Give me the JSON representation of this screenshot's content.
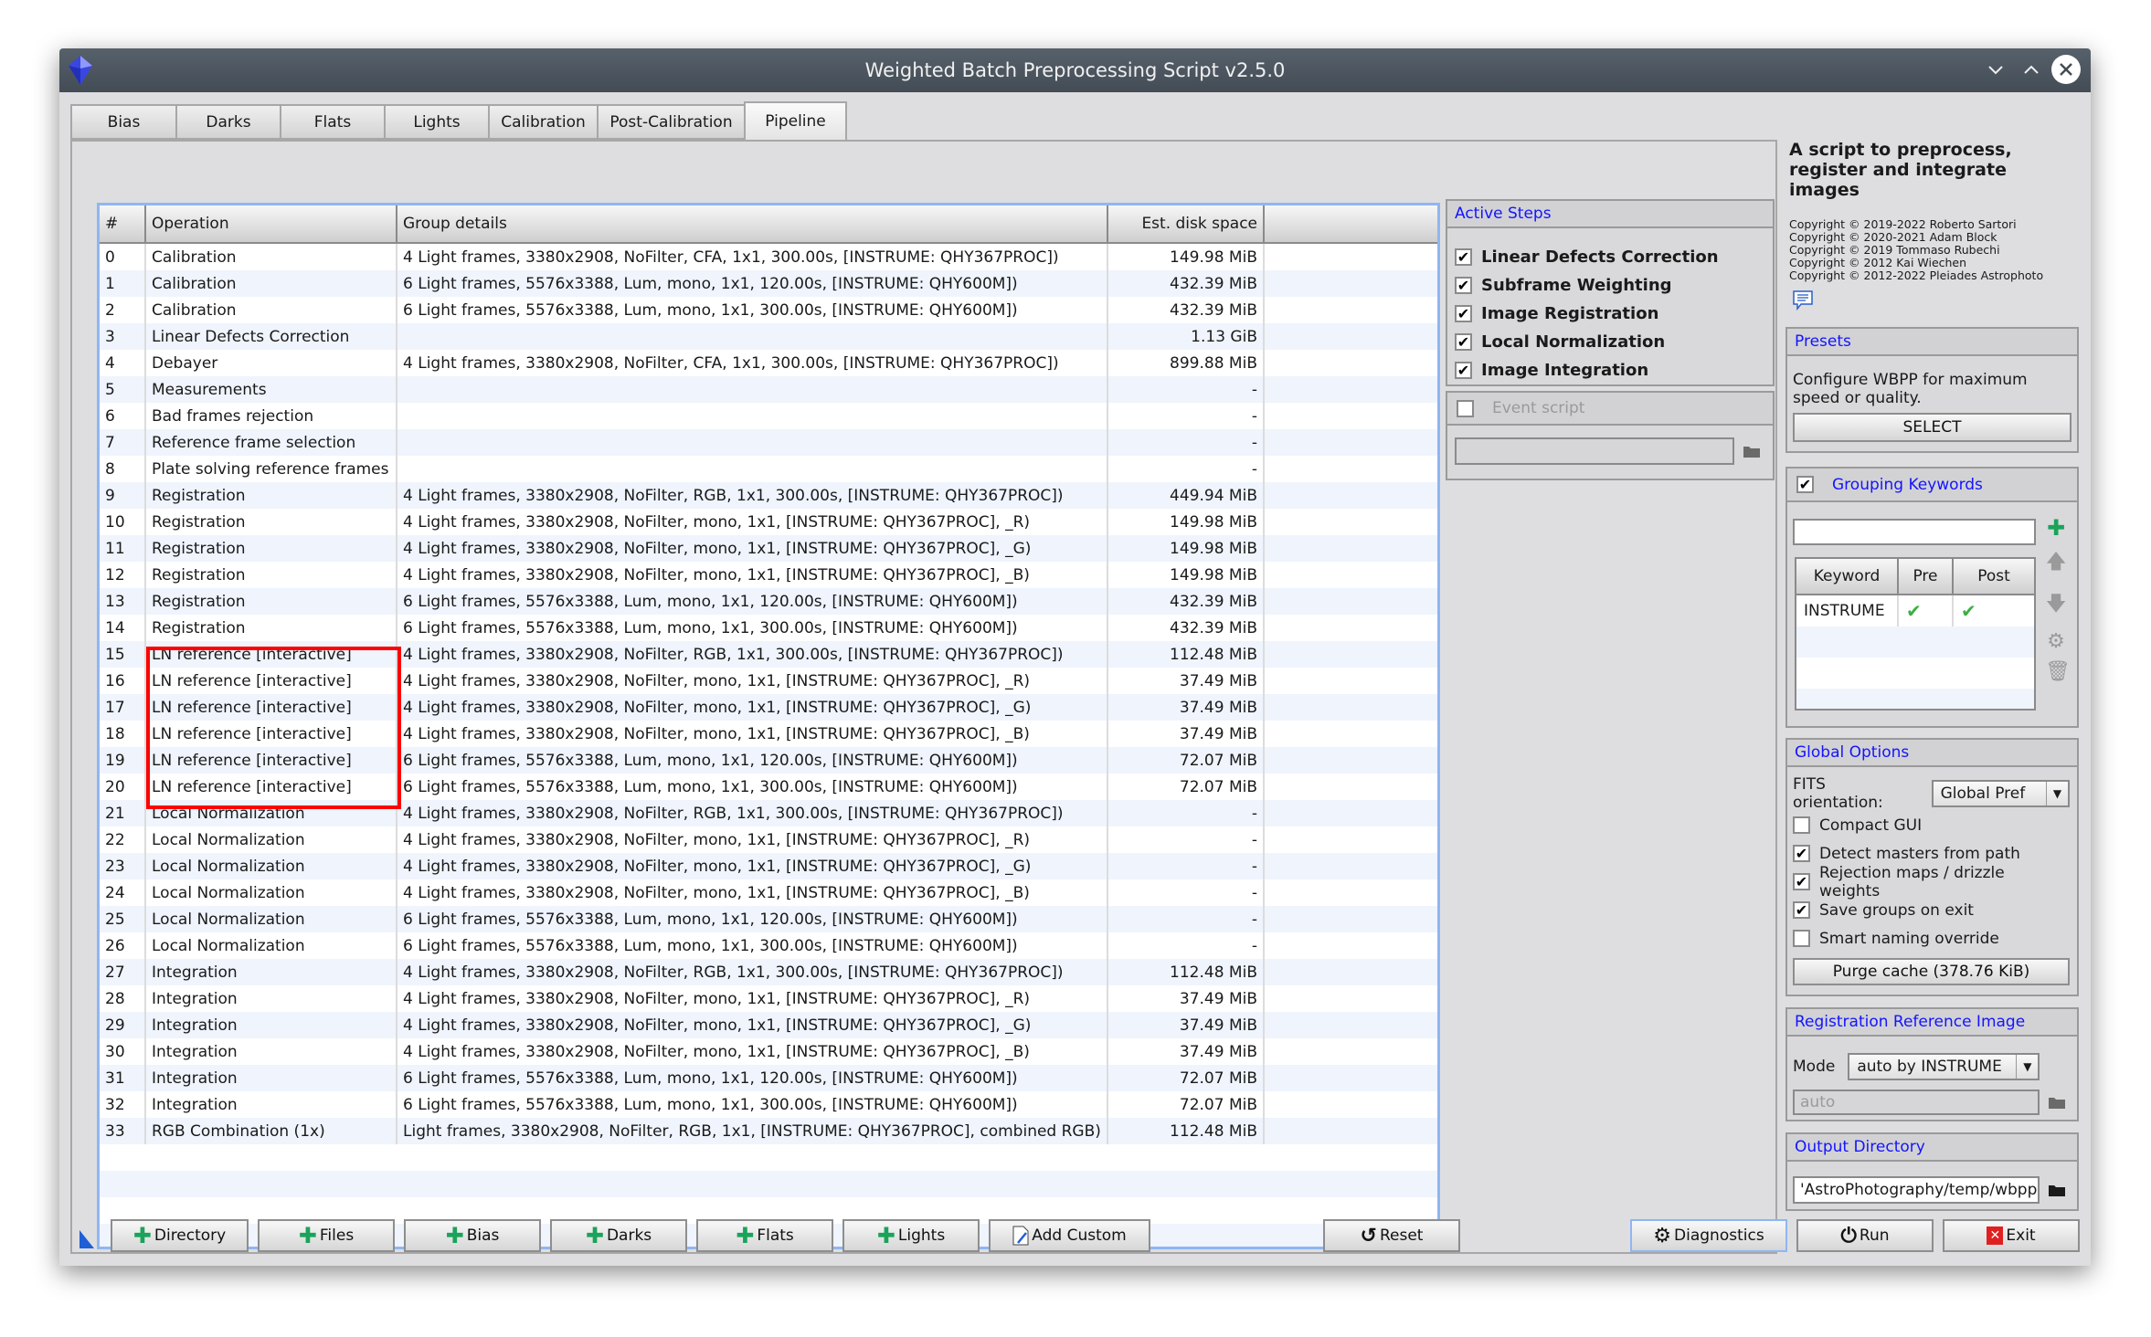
{
  "window": {
    "title": "Weighted Batch Preprocessing Script v2.5.0"
  },
  "tabs": [
    {
      "label": "Bias",
      "active": false
    },
    {
      "label": "Darks",
      "active": false
    },
    {
      "label": "Flats",
      "active": false
    },
    {
      "label": "Lights",
      "active": false
    },
    {
      "label": "Calibration",
      "active": false
    },
    {
      "label": "Post-Calibration",
      "active": false
    },
    {
      "label": "Pipeline",
      "active": true
    }
  ],
  "pipeline_table": {
    "headers": [
      "#",
      "Operation",
      "Group details",
      "Est. disk space",
      ""
    ],
    "rows": [
      {
        "n": "0",
        "op": "Calibration",
        "details": "4 Light frames, 3380x2908, NoFilter, CFA, 1x1, 300.00s, [INSTRUME: QHY367PROC])",
        "disk": "149.98 MiB"
      },
      {
        "n": "1",
        "op": "Calibration",
        "details": "6 Light frames, 5576x3388, Lum, mono, 1x1, 120.00s, [INSTRUME: QHY600M])",
        "disk": "432.39 MiB"
      },
      {
        "n": "2",
        "op": "Calibration",
        "details": "6 Light frames, 5576x3388, Lum, mono, 1x1, 300.00s, [INSTRUME: QHY600M])",
        "disk": "432.39 MiB"
      },
      {
        "n": "3",
        "op": "Linear Defects Correction",
        "details": "",
        "disk": "1.13 GiB"
      },
      {
        "n": "4",
        "op": "Debayer",
        "details": "4 Light frames, 3380x2908, NoFilter, CFA, 1x1, 300.00s, [INSTRUME: QHY367PROC])",
        "disk": "899.88 MiB"
      },
      {
        "n": "5",
        "op": "Measurements",
        "details": "",
        "disk": "-"
      },
      {
        "n": "6",
        "op": "Bad frames rejection",
        "details": "",
        "disk": "-"
      },
      {
        "n": "7",
        "op": "Reference frame selection",
        "details": "",
        "disk": "-"
      },
      {
        "n": "8",
        "op": "Plate solving reference frames",
        "details": "",
        "disk": "-"
      },
      {
        "n": "9",
        "op": "Registration",
        "details": "4 Light frames, 3380x2908, NoFilter, RGB, 1x1, 300.00s, [INSTRUME: QHY367PROC])",
        "disk": "449.94 MiB"
      },
      {
        "n": "10",
        "op": "Registration",
        "details": "4 Light frames, 3380x2908, NoFilter, mono, 1x1, [INSTRUME: QHY367PROC], _R)",
        "disk": "149.98 MiB"
      },
      {
        "n": "11",
        "op": "Registration",
        "details": "4 Light frames, 3380x2908, NoFilter, mono, 1x1, [INSTRUME: QHY367PROC], _G)",
        "disk": "149.98 MiB"
      },
      {
        "n": "12",
        "op": "Registration",
        "details": "4 Light frames, 3380x2908, NoFilter, mono, 1x1, [INSTRUME: QHY367PROC], _B)",
        "disk": "149.98 MiB"
      },
      {
        "n": "13",
        "op": "Registration",
        "details": "6 Light frames, 5576x3388, Lum, mono, 1x1, 120.00s, [INSTRUME: QHY600M])",
        "disk": "432.39 MiB"
      },
      {
        "n": "14",
        "op": "Registration",
        "details": "6 Light frames, 5576x3388, Lum, mono, 1x1, 300.00s, [INSTRUME: QHY600M])",
        "disk": "432.39 MiB"
      },
      {
        "n": "15",
        "op": "LN reference [interactive]",
        "details": "4 Light frames, 3380x2908, NoFilter, RGB, 1x1, 300.00s, [INSTRUME: QHY367PROC])",
        "disk": "112.48 MiB"
      },
      {
        "n": "16",
        "op": "LN reference [interactive]",
        "details": "4 Light frames, 3380x2908, NoFilter, mono, 1x1, [INSTRUME: QHY367PROC], _R)",
        "disk": "37.49 MiB"
      },
      {
        "n": "17",
        "op": "LN reference [interactive]",
        "details": "4 Light frames, 3380x2908, NoFilter, mono, 1x1, [INSTRUME: QHY367PROC], _G)",
        "disk": "37.49 MiB"
      },
      {
        "n": "18",
        "op": "LN reference [interactive]",
        "details": "4 Light frames, 3380x2908, NoFilter, mono, 1x1, [INSTRUME: QHY367PROC], _B)",
        "disk": "37.49 MiB"
      },
      {
        "n": "19",
        "op": "LN reference [interactive]",
        "details": "6 Light frames, 5576x3388, Lum, mono, 1x1, 120.00s, [INSTRUME: QHY600M])",
        "disk": "72.07 MiB"
      },
      {
        "n": "20",
        "op": "LN reference [interactive]",
        "details": "6 Light frames, 5576x3388, Lum, mono, 1x1, 300.00s, [INSTRUME: QHY600M])",
        "disk": "72.07 MiB"
      },
      {
        "n": "21",
        "op": "Local Normalization",
        "details": "4 Light frames, 3380x2908, NoFilter, RGB, 1x1, 300.00s, [INSTRUME: QHY367PROC])",
        "disk": "-"
      },
      {
        "n": "22",
        "op": "Local Normalization",
        "details": "4 Light frames, 3380x2908, NoFilter, mono, 1x1, [INSTRUME: QHY367PROC], _R)",
        "disk": "-"
      },
      {
        "n": "23",
        "op": "Local Normalization",
        "details": "4 Light frames, 3380x2908, NoFilter, mono, 1x1, [INSTRUME: QHY367PROC], _G)",
        "disk": "-"
      },
      {
        "n": "24",
        "op": "Local Normalization",
        "details": "4 Light frames, 3380x2908, NoFilter, mono, 1x1, [INSTRUME: QHY367PROC], _B)",
        "disk": "-"
      },
      {
        "n": "25",
        "op": "Local Normalization",
        "details": "6 Light frames, 5576x3388, Lum, mono, 1x1, 120.00s, [INSTRUME: QHY600M])",
        "disk": "-"
      },
      {
        "n": "26",
        "op": "Local Normalization",
        "details": "6 Light frames, 5576x3388, Lum, mono, 1x1, 300.00s, [INSTRUME: QHY600M])",
        "disk": "-"
      },
      {
        "n": "27",
        "op": "Integration",
        "details": "4 Light frames, 3380x2908, NoFilter, RGB, 1x1, 300.00s, [INSTRUME: QHY367PROC])",
        "disk": "112.48 MiB"
      },
      {
        "n": "28",
        "op": "Integration",
        "details": "4 Light frames, 3380x2908, NoFilter, mono, 1x1, [INSTRUME: QHY367PROC], _R)",
        "disk": "37.49 MiB"
      },
      {
        "n": "29",
        "op": "Integration",
        "details": "4 Light frames, 3380x2908, NoFilter, mono, 1x1, [INSTRUME: QHY367PROC], _G)",
        "disk": "37.49 MiB"
      },
      {
        "n": "30",
        "op": "Integration",
        "details": "4 Light frames, 3380x2908, NoFilter, mono, 1x1, [INSTRUME: QHY367PROC], _B)",
        "disk": "37.49 MiB"
      },
      {
        "n": "31",
        "op": "Integration",
        "details": "6 Light frames, 5576x3388, Lum, mono, 1x1, 120.00s, [INSTRUME: QHY600M])",
        "disk": "72.07 MiB"
      },
      {
        "n": "32",
        "op": "Integration",
        "details": "6 Light frames, 5576x3388, Lum, mono, 1x1, 300.00s, [INSTRUME: QHY600M])",
        "disk": "72.07 MiB"
      },
      {
        "n": "33",
        "op": "RGB Combination (1x)",
        "details": "Light frames, 3380x2908, NoFilter, RGB, 1x1, [INSTRUME: QHY367PROC], combined RGB)",
        "disk": "112.48 MiB"
      }
    ],
    "highlighted_rows": [
      "15",
      "16",
      "17",
      "18",
      "19",
      "20"
    ]
  },
  "active_steps": {
    "title": "Active Steps",
    "items": [
      {
        "label": "Linear Defects Correction",
        "checked": true
      },
      {
        "label": "Subframe Weighting",
        "checked": true
      },
      {
        "label": "Image Registration",
        "checked": true
      },
      {
        "label": "Local Normalization",
        "checked": true
      },
      {
        "label": "Image Integration",
        "checked": true
      }
    ]
  },
  "event_script": {
    "label": "Event script",
    "checked": false,
    "value": ""
  },
  "about": {
    "heading": "A script to preprocess, register and integrate images",
    "copyrights": [
      "Copyright © 2019-2022 Roberto Sartori",
      "Copyright © 2020-2021 Adam Block",
      "Copyright © 2019 Tommaso Rubechi",
      "Copyright © 2012 Kai Wiechen",
      "Copyright © 2012-2022 Pleiades Astrophoto"
    ]
  },
  "presets": {
    "title": "Presets",
    "description": "Configure WBPP for maximum speed or quality.",
    "select_label": "SELECT"
  },
  "grouping_keywords": {
    "title": "Grouping Keywords",
    "enabled": true,
    "input_value": "",
    "headers": [
      "Keyword",
      "Pre",
      "Post"
    ],
    "rows": [
      {
        "keyword": "INSTRUME",
        "pre": true,
        "post": true
      }
    ]
  },
  "global_options": {
    "title": "Global Options",
    "fits_orientation_label": "FITS orientation:",
    "fits_orientation_value": "Global Pref",
    "options": [
      {
        "label": "Compact GUI",
        "checked": false
      },
      {
        "label": "Detect masters from path",
        "checked": true
      },
      {
        "label": "Rejection maps / drizzle weights",
        "checked": true
      },
      {
        "label": "Save groups on exit",
        "checked": true
      },
      {
        "label": "Smart naming override",
        "checked": false
      }
    ],
    "purge_label": "Purge cache (378.76 KiB)"
  },
  "registration_reference": {
    "title": "Registration Reference Image",
    "mode_label": "Mode",
    "mode_value": "auto by INSTRUME",
    "path_value": "auto"
  },
  "output_directory": {
    "title": "Output Directory",
    "value": "'AstroPhotography/temp/wbpp"
  },
  "bottom_buttons": {
    "directory": "Directory",
    "files": "Files",
    "bias": "Bias",
    "darks": "Darks",
    "flats": "Flats",
    "lights": "Lights",
    "add_custom": "Add Custom",
    "reset": "Reset",
    "diagnostics": "Diagnostics",
    "run": "Run",
    "exit": "Exit"
  },
  "colors": {
    "accent_blue": "#1414ff",
    "highlight_red": "#ff0000",
    "add_green": "#1aa35a",
    "check_green": "#3cb043",
    "exit_red": "#e02020"
  }
}
